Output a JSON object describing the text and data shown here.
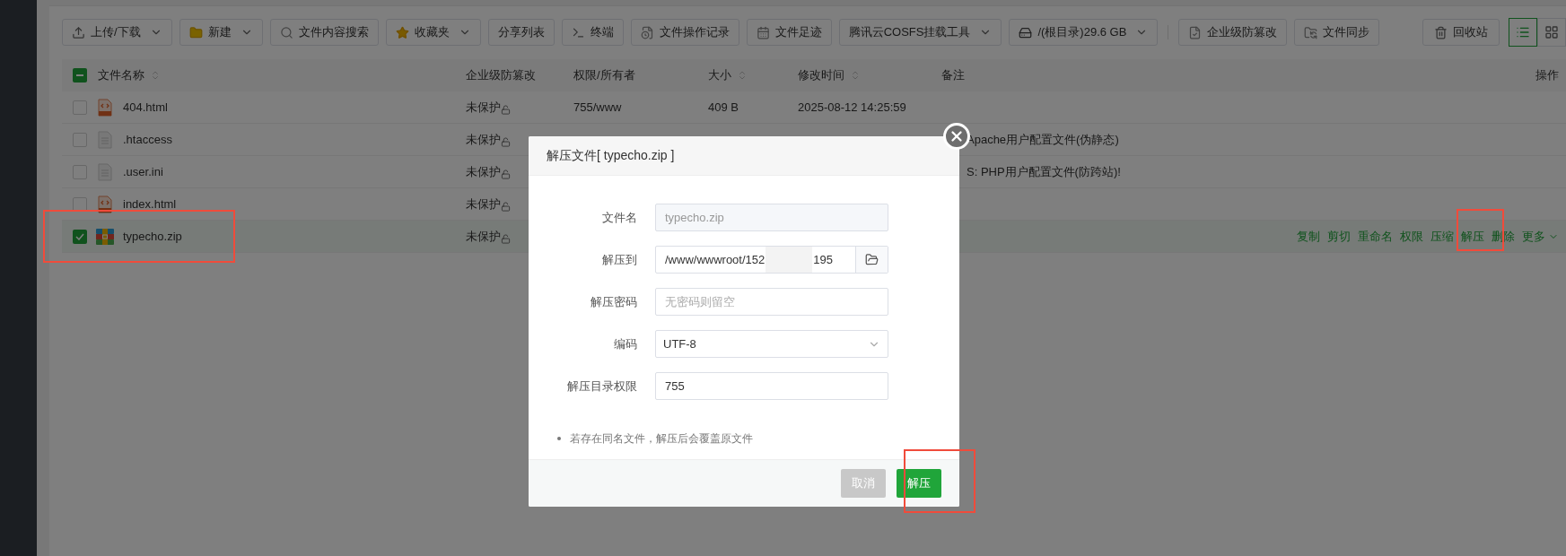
{
  "toolbar": {
    "buttons": [
      {
        "label": "上传/下载",
        "dropdown": true
      },
      {
        "label": "新建",
        "dropdown": true
      },
      {
        "label": "文件内容搜索",
        "dropdown": false
      },
      {
        "label": "收藏夹",
        "dropdown": true
      },
      {
        "label": "分享列表",
        "dropdown": false
      },
      {
        "label": "终端",
        "dropdown": false
      },
      {
        "label": "文件操作记录",
        "dropdown": false
      },
      {
        "label": "文件足迹",
        "dropdown": false
      },
      {
        "label": "腾讯云COSFS挂载工具",
        "dropdown": true
      },
      {
        "label": "/(根目录)29.6 GB",
        "dropdown": true
      }
    ],
    "extra_buttons": [
      {
        "label": "企业级防篡改",
        "dropdown": false
      },
      {
        "label": "文件同步",
        "dropdown": false
      }
    ],
    "recycle_button": {
      "label": "回收站"
    },
    "view_modes": [
      {
        "selected": true
      },
      {
        "selected": false
      }
    ]
  },
  "table": {
    "select_all": {
      "indeterminate": true
    },
    "columns": [
      {
        "label": "文件名称",
        "sortable": true
      },
      {
        "label": "企业级防篡改",
        "sortable": false
      },
      {
        "label": "权限/所有者",
        "sortable": false
      },
      {
        "label": "大小",
        "sortable": true
      },
      {
        "label": "修改时间",
        "sortable": true
      },
      {
        "label": "备注",
        "sortable": false
      },
      {
        "label": "操作",
        "sortable": false
      }
    ],
    "rows": [
      {
        "name": "404.html",
        "kind": "html",
        "selected": false,
        "protection": "未保护",
        "permission": "755/www",
        "size": "409 B",
        "modified": "2025-08-12 14:25:59"
      },
      {
        "name": ".htaccess",
        "kind": "text",
        "selected": false,
        "protection": "未保护",
        "note": "Apache用户配置文件(伪静态)"
      },
      {
        "name": ".user.ini",
        "kind": "text",
        "selected": false,
        "protection": "未保护",
        "note": "S: PHP用户配置文件(防跨站)!"
      },
      {
        "name": "index.html",
        "kind": "html",
        "selected": false,
        "protection": "未保护"
      },
      {
        "name": "typecho.zip",
        "kind": "zip",
        "selected": true,
        "protection": "未保护",
        "actions": [
          {
            "label": "复制",
            "dropdown": false
          },
          {
            "label": "剪切",
            "dropdown": false
          },
          {
            "label": "重命名",
            "dropdown": false
          },
          {
            "label": "权限",
            "dropdown": false
          },
          {
            "label": "压缩",
            "dropdown": false
          },
          {
            "label": "解压",
            "dropdown": false
          },
          {
            "label": "删除",
            "dropdown": false
          },
          {
            "label": "更多",
            "dropdown": true
          }
        ]
      }
    ]
  },
  "dialog": {
    "title": "解压文件[ typecho.zip ]",
    "fields": [
      {
        "kind": "readonly",
        "label": "文件名",
        "value": "typecho.zip"
      },
      {
        "kind": "path",
        "label": "解压到",
        "value_start": "/www/wwwroot/152",
        "value_end": "195"
      },
      {
        "kind": "password",
        "label": "解压密码",
        "placeholder": "无密码则留空"
      },
      {
        "kind": "select",
        "label": "编码",
        "value": "UTF-8"
      },
      {
        "kind": "text",
        "label": "解压目录权限",
        "value": "755"
      }
    ],
    "notes": [
      "若存在同名文件，解压后会覆盖原文件"
    ],
    "buttons": [
      {
        "label": "取消",
        "kind": "cancel"
      },
      {
        "label": "解压",
        "kind": "primary"
      }
    ]
  }
}
